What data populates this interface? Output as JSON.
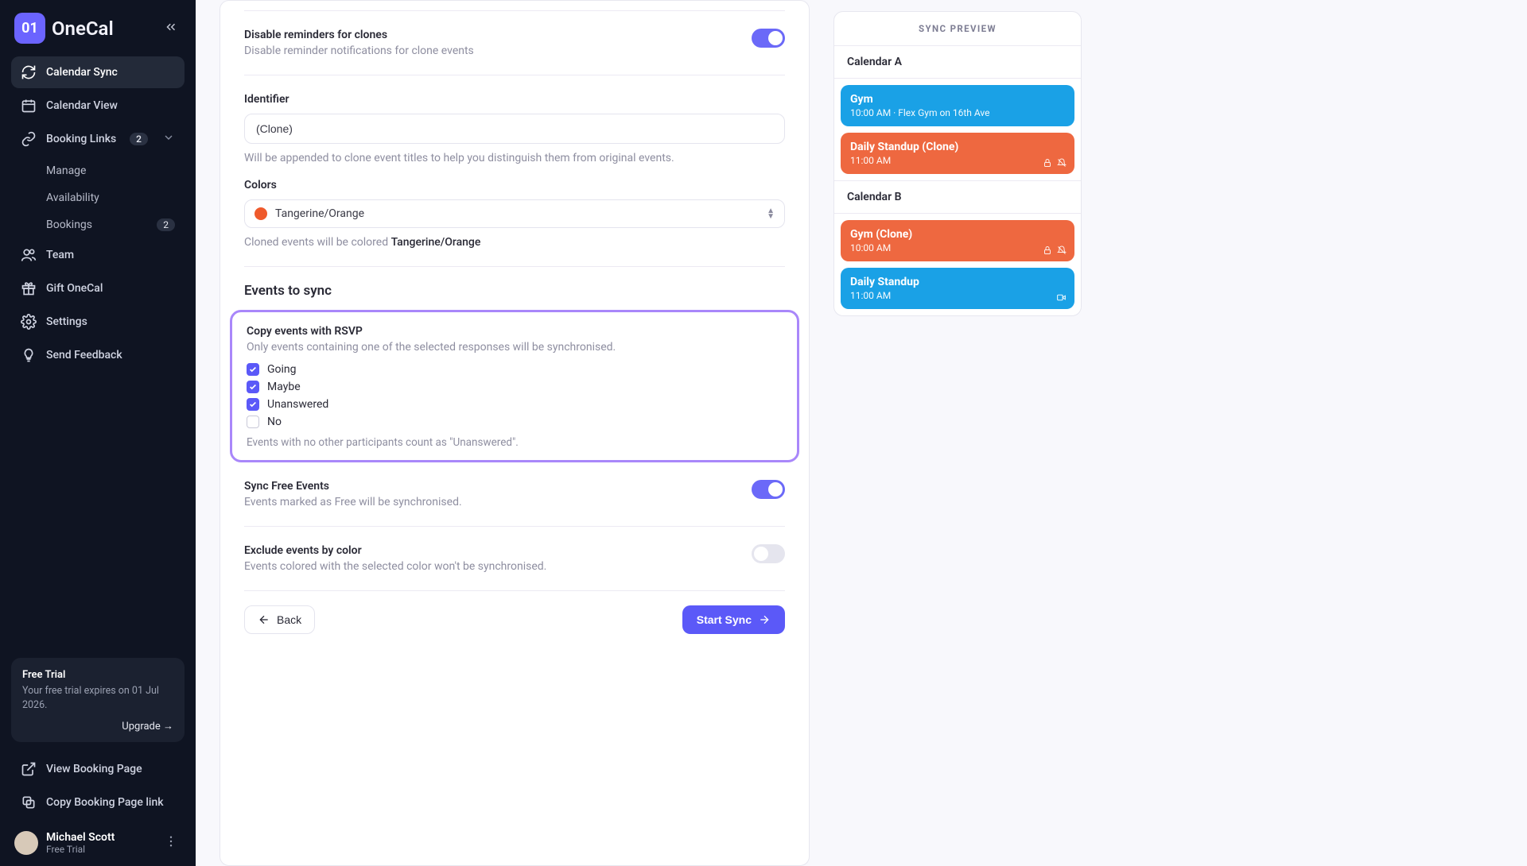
{
  "brand": {
    "mark": "01",
    "name": "OneCal"
  },
  "sidebar": {
    "items": [
      {
        "label": "Calendar Sync"
      },
      {
        "label": "Calendar View"
      },
      {
        "label": "Booking Links",
        "badge": "2"
      },
      {
        "label": "Team"
      },
      {
        "label": "Gift OneCal"
      },
      {
        "label": "Settings"
      },
      {
        "label": "Send Feedback"
      }
    ],
    "sub_items": [
      {
        "label": "Manage"
      },
      {
        "label": "Availability"
      },
      {
        "label": "Bookings",
        "badge": "2"
      }
    ],
    "trial": {
      "title": "Free Trial",
      "text": "Your free trial expires on 01 Jul 2026.",
      "upgrade": "Upgrade →"
    },
    "links": [
      {
        "label": "View Booking Page"
      },
      {
        "label": "Copy Booking Page link"
      }
    ],
    "user": {
      "name": "Michael Scott",
      "plan": "Free Trial"
    }
  },
  "settings": {
    "disable_reminders": {
      "title": "Disable reminders for clones",
      "sub": "Disable reminder notifications for clone events"
    },
    "identifier": {
      "label": "Identifier",
      "value": "(Clone)",
      "helper": "Will be appended to clone event titles to help you distinguish them from original events."
    },
    "colors": {
      "label": "Colors",
      "value": "Tangerine/Orange",
      "swatch": "#ef5a2c",
      "helper_prefix": "Cloned events will be colored ",
      "helper_color": "Tangerine/Orange"
    },
    "events_section_title": "Events to sync",
    "rsvp": {
      "title": "Copy events with RSVP",
      "sub": "Only events containing one of the selected responses will be synchronised.",
      "opts": [
        {
          "label": "Going",
          "checked": true
        },
        {
          "label": "Maybe",
          "checked": true
        },
        {
          "label": "Unanswered",
          "checked": true
        },
        {
          "label": "No",
          "checked": false
        }
      ],
      "note": "Events with no other participants count as \"Unanswered\"."
    },
    "sync_free": {
      "title": "Sync Free Events",
      "sub": "Events marked as Free will be synchronised."
    },
    "exclude_color": {
      "title": "Exclude events by color",
      "sub": "Events colored with the selected color won't be synchronised."
    },
    "back": "Back",
    "start": "Start Sync"
  },
  "preview": {
    "header": "SYNC PREVIEW",
    "cal_a": {
      "name": "Calendar A",
      "events": [
        {
          "title": "Gym",
          "sub": "10:00 AM · Flex Gym on 16th Ave",
          "style": "blue"
        },
        {
          "title": "Daily Standup (Clone)",
          "sub": "11:00 AM",
          "style": "orange",
          "icons": true
        }
      ]
    },
    "cal_b": {
      "name": "Calendar B",
      "events": [
        {
          "title": "Gym (Clone)",
          "sub": "10:00 AM",
          "style": "orange",
          "icons": true
        },
        {
          "title": "Daily Standup",
          "sub": "11:00 AM",
          "style": "blue",
          "video": true
        }
      ]
    }
  }
}
